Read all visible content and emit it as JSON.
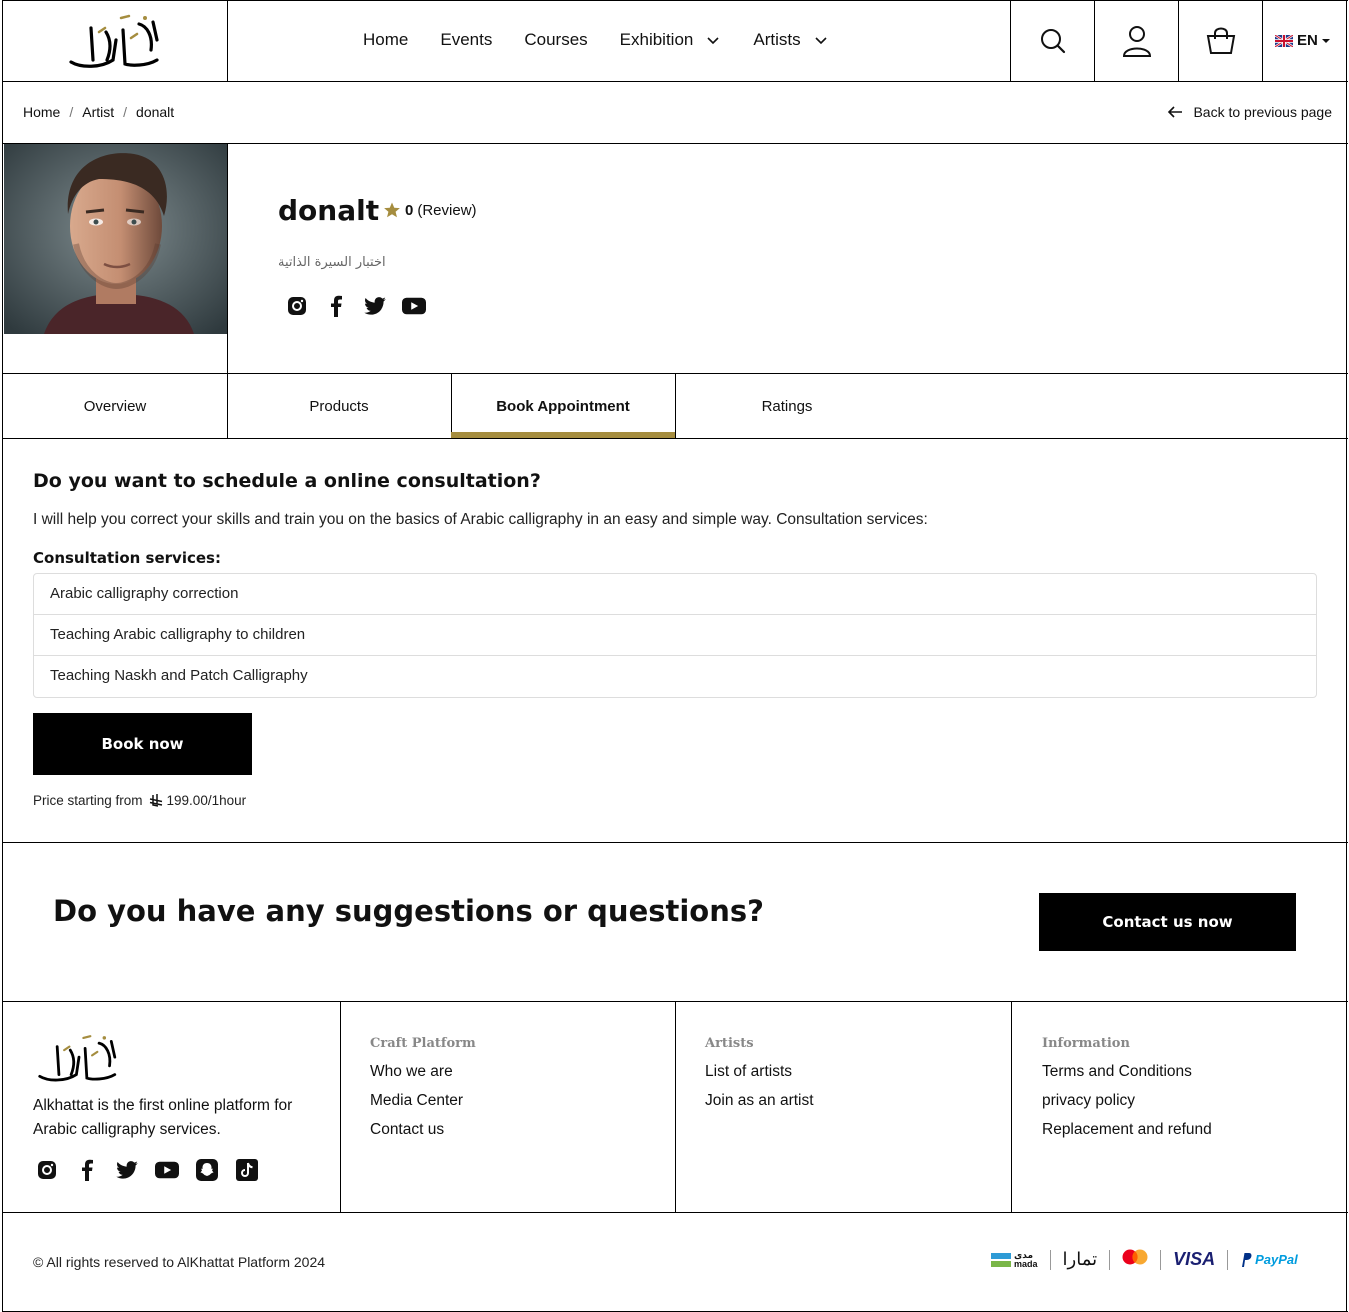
{
  "header": {
    "nav": [
      {
        "label": "Home",
        "dropdown": false
      },
      {
        "label": "Events",
        "dropdown": false
      },
      {
        "label": "Courses",
        "dropdown": false
      },
      {
        "label": "Exhibition",
        "dropdown": true
      },
      {
        "label": "Artists",
        "dropdown": true
      }
    ],
    "language": "EN",
    "icons": [
      "search-icon",
      "user-icon",
      "cart-icon"
    ]
  },
  "breadcrumb": {
    "items": [
      "Home",
      "Artist",
      "donalt"
    ],
    "separator": "/",
    "back_label": "Back to previous page"
  },
  "profile": {
    "name": "donalt",
    "rating_value": "0",
    "rating_label": "(Review)",
    "bio": "اختبار السيرة الذاتية",
    "socials": [
      "instagram-icon",
      "facebook-icon",
      "twitter-icon",
      "youtube-icon"
    ]
  },
  "tabs": [
    {
      "label": "Overview",
      "active": false
    },
    {
      "label": "Products",
      "active": false
    },
    {
      "label": "Book Appointment",
      "active": true
    },
    {
      "label": "Ratings",
      "active": false
    }
  ],
  "appointment": {
    "title": "Do you want to schedule a online consultation?",
    "description": "I will help you correct your skills and train you on the basics of Arabic calligraphy in an easy and simple way. Consultation services:",
    "services_title": "Consultation services:",
    "services": [
      "Arabic calligraphy correction",
      "Teaching Arabic calligraphy to children",
      "Teaching Naskh and Patch Calligraphy"
    ],
    "book_label": "Book now",
    "price_prefix": "Price starting from",
    "price_value": "199.00/1hour"
  },
  "suggestions": {
    "title": "Do you have any suggestions or questions?",
    "button": "Contact us now"
  },
  "footer": {
    "description": "Alkhattat is the first online platform for Arabic calligraphy services.",
    "socials": [
      "instagram-icon",
      "facebook-icon",
      "twitter-icon",
      "youtube-icon",
      "snapchat-icon",
      "tiktok-icon"
    ],
    "columns": [
      {
        "title": "Craft Platform",
        "links": [
          "Who we are",
          "Media Center",
          "Contact us"
        ]
      },
      {
        "title": "Artists",
        "links": [
          "List of artists",
          "Join as an artist"
        ]
      },
      {
        "title": "Information",
        "links": [
          "Terms and Conditions",
          "privacy policy",
          "Replacement and refund"
        ]
      }
    ],
    "copyright": "© All rights reserved to AlKhattat Platform 2024",
    "payments": {
      "mada_ar": "مدى",
      "mada": "mada",
      "tamara": "تمارا",
      "visa": "VISA",
      "paypal": "PayPal"
    }
  },
  "colors": {
    "accent": "#a58d3f",
    "star": "#a58d3f",
    "border": "#000000"
  }
}
